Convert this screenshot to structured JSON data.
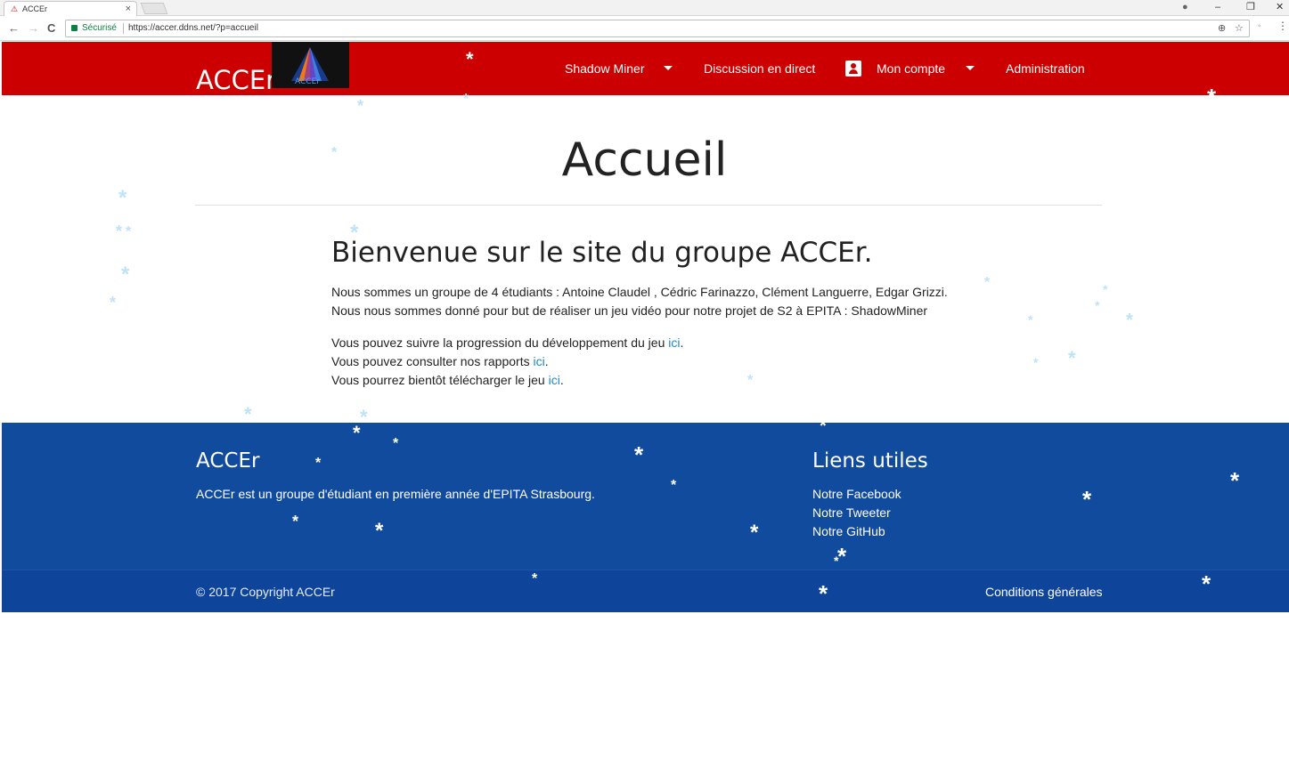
{
  "browser": {
    "tab_title": "ACCEr",
    "tab_close": "×",
    "tab_favicon": "⚠",
    "secure_label": "Sécurisé",
    "url": "https://accer.ddns.net/?p=accueil",
    "controls": {
      "minimize": "–",
      "restore": "❐",
      "close": "✕",
      "profile": "●"
    },
    "nav": {
      "back": "←",
      "forward": "→",
      "reload": "C"
    },
    "omnibox_icons": {
      "zoom": "⊕",
      "star": "☆"
    },
    "extension_icon": "◦",
    "menu_icon": "⋮"
  },
  "header": {
    "brand": "ACCEr",
    "logo_text": "ACCEr",
    "nav": [
      {
        "label": "Shadow Miner",
        "dropdown": true
      },
      {
        "label": "Discussion en direct",
        "dropdown": false
      },
      {
        "label": "Mon compte",
        "dropdown": true
      },
      {
        "label": "Administration",
        "dropdown": false
      }
    ]
  },
  "main": {
    "title": "Accueil",
    "welcome": "Bienvenue sur le site du groupe ACCEr.",
    "intro_line1": "Nous sommes un groupe de 4 étudiants : Antoine Claudel , Cédric Farinazzo, Clément Languerre, Edgar Grizzi.",
    "intro_line2": "Nous nous sommes donné pour but de réaliser un jeu vidéo pour notre projet de S2 à EPITA : ShadowMiner",
    "follow_text": "Vous pouvez suivre la progression du développement du jeu",
    "consult_text": "Vous pouvez consulter nos rapports",
    "download_text": "Vous pourrez bientôt télécharger le jeu",
    "link_label": "ici",
    "period": "."
  },
  "footer": {
    "about_title": "ACCEr",
    "about_text": "ACCEr est un groupe d'étudiant en première année d'EPITA Strasbourg.",
    "links_title": "Liens utiles",
    "links": [
      "Notre Facebook",
      "Notre Tweeter",
      "Notre GitHub"
    ],
    "copyright": "© 2017 Copyright ACCEr",
    "terms": "Conditions générales"
  },
  "snow_glyph": "*",
  "colors": {
    "header_bg": "#cc0000",
    "footer_bg": "#114b9e",
    "link": "#1e88c8",
    "secure": "#0b8043"
  }
}
